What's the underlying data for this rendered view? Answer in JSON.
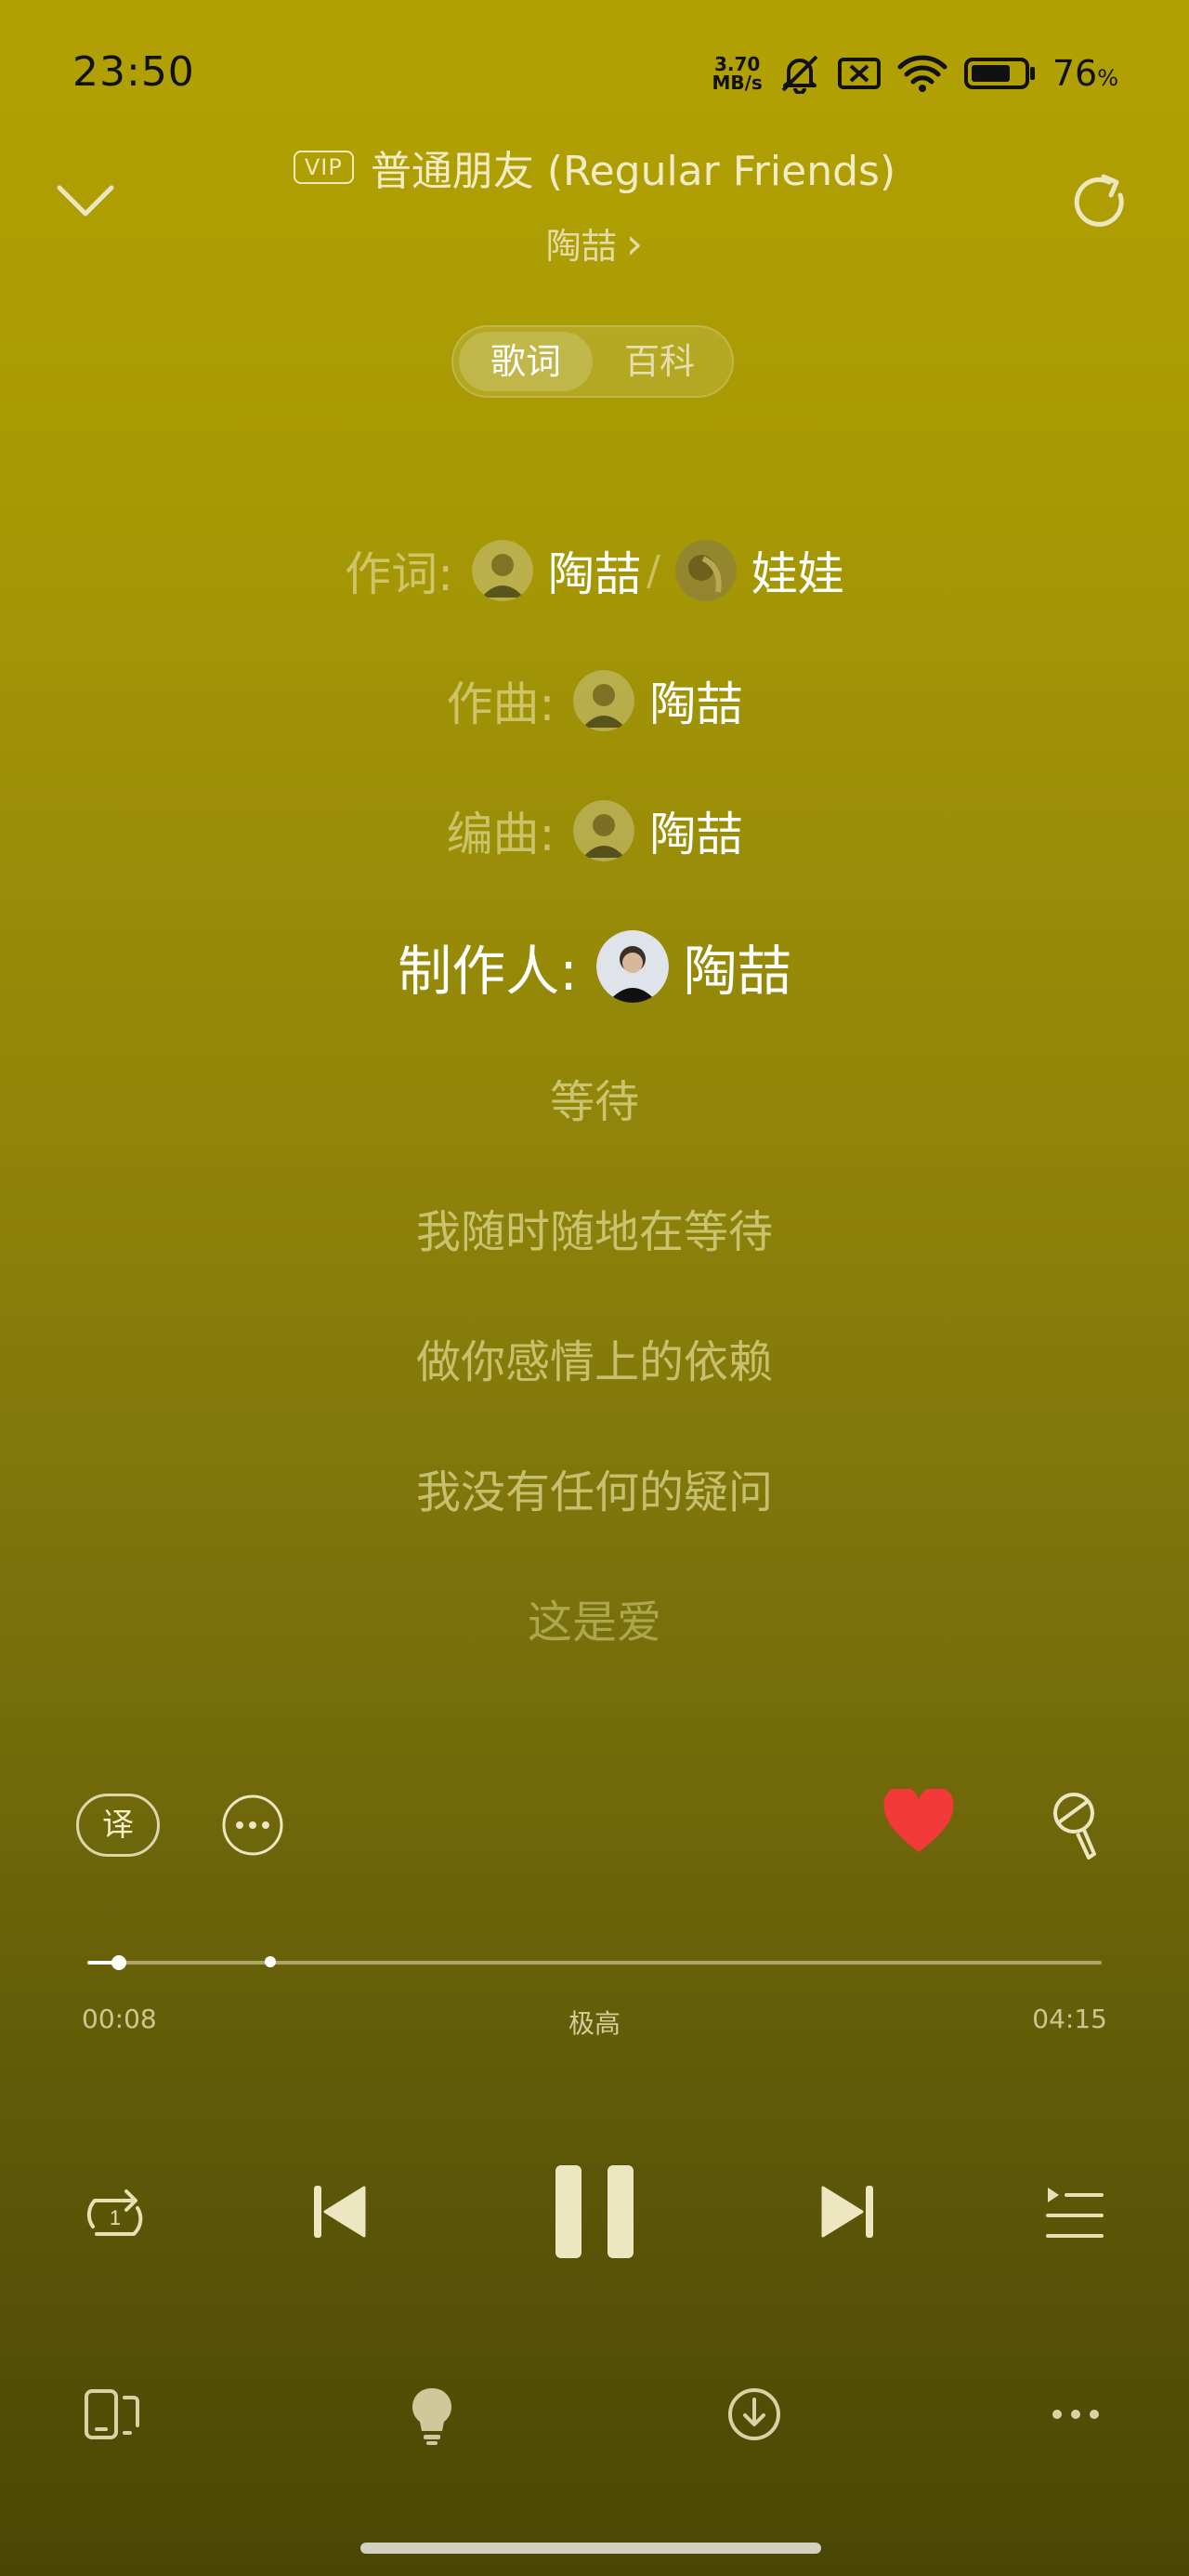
{
  "status_bar": {
    "time": "23:50",
    "net_speed_value": "3.70",
    "net_speed_unit": "MB/s",
    "battery_percent": "76",
    "battery_unit": "%",
    "battery_level": 0.76
  },
  "header": {
    "vip_label": "VIP",
    "title": "普通朋友 (Regular Friends)",
    "artist": "陶喆",
    "artist_chevron": "›"
  },
  "tabs": [
    {
      "label": "歌词",
      "active": true
    },
    {
      "label": "百科",
      "active": false
    }
  ],
  "credits": {
    "lyricist_label": "作词:",
    "lyricist_1": "陶喆",
    "separator": "/",
    "lyricist_2": "娃娃",
    "composer_label": "作曲:",
    "composer": "陶喆",
    "arranger_label": "编曲:",
    "arranger": "陶喆",
    "producer_label": "制作人:",
    "producer": "陶喆"
  },
  "lyrics": [
    "等待",
    "我随时随地在等待",
    "做你感情上的依赖",
    "我没有任何的疑问",
    "这是爱"
  ],
  "actions": {
    "translate_label": "译",
    "liked": true,
    "heart_color": "#f23a3a"
  },
  "progress": {
    "current": "00:08",
    "total": "04:15",
    "quality": "极高",
    "played_fraction": 0.031,
    "buffered_fraction": 0.18
  },
  "icons": {
    "collapse": "chevron-down-icon",
    "share": "share-icon",
    "repeat": "repeat-one-icon",
    "prev": "skip-previous-icon",
    "pause": "pause-icon",
    "next": "skip-next-icon",
    "playlist": "playlist-icon",
    "device": "device-switch-icon",
    "light": "light-bulb-icon",
    "download": "download-icon",
    "more": "more-horizontal-icon"
  }
}
